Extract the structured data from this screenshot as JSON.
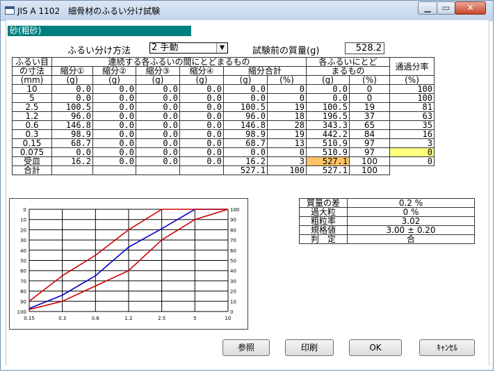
{
  "window": {
    "title": "JIS A 1102　細骨材のふるい分け試験"
  },
  "sample_name": "砂(粗砂)",
  "method": {
    "label": "ふるい分け方法",
    "value": "2 手動"
  },
  "mass_before": {
    "label": "試験前の質量(g)",
    "value": "528.2"
  },
  "table": {
    "headers": {
      "sieve_top": "ふるい目",
      "sieve_bottom": "の寸法",
      "between": "連続する各ふるいの間にとどまるもの",
      "retained_top": "各ふるいにとど",
      "retained_bottom": "まるもの",
      "passing": "通過分率",
      "div1": "縮分①",
      "div2": "縮分②",
      "div3": "縮分③",
      "div4": "縮分④",
      "div_total": "縮分合計"
    },
    "units": [
      "(mm)",
      "(g)",
      "(g)",
      "(g)",
      "(g)",
      "(g)",
      "(%)",
      "(g)",
      "(%)",
      "(%)"
    ],
    "rows": [
      {
        "sieve": "10",
        "d1": "0.0",
        "d2": "0.0",
        "d3": "0.0",
        "d4": "0.0",
        "tg": "0.0",
        "tp": "0",
        "rg": "0.0",
        "rp": "0",
        "pass": "100"
      },
      {
        "sieve": "5",
        "d1": "0.0",
        "d2": "0.0",
        "d3": "0.0",
        "d4": "0.0",
        "tg": "0.0",
        "tp": "0",
        "rg": "0.0",
        "rp": "0",
        "pass": "100"
      },
      {
        "sieve": "2.5",
        "d1": "100.5",
        "d2": "0.0",
        "d3": "0.0",
        "d4": "0.0",
        "tg": "100.5",
        "tp": "19",
        "rg": "100.5",
        "rp": "19",
        "pass": "81"
      },
      {
        "sieve": "1.2",
        "d1": "96.0",
        "d2": "0.0",
        "d3": "0.0",
        "d4": "0.0",
        "tg": "96.0",
        "tp": "18",
        "rg": "196.5",
        "rp": "37",
        "pass": "63"
      },
      {
        "sieve": "0.6",
        "d1": "146.8",
        "d2": "0.0",
        "d3": "0.0",
        "d4": "0.0",
        "tg": "146.8",
        "tp": "28",
        "rg": "343.3",
        "rp": "65",
        "pass": "35"
      },
      {
        "sieve": "0.3",
        "d1": "98.9",
        "d2": "0.0",
        "d3": "0.0",
        "d4": "0.0",
        "tg": "98.9",
        "tp": "19",
        "rg": "442.2",
        "rp": "84",
        "pass": "16"
      },
      {
        "sieve": "0.15",
        "d1": "68.7",
        "d2": "0.0",
        "d3": "0.0",
        "d4": "0.0",
        "tg": "68.7",
        "tp": "13",
        "rg": "510.9",
        "rp": "97",
        "pass": "3"
      },
      {
        "sieve": "0.075",
        "d1": "0.0",
        "d2": "0.0",
        "d3": "0.0",
        "d4": "0.0",
        "tg": "0.0",
        "tp": "0",
        "rg": "510.9",
        "rp": "97",
        "pass": "0"
      }
    ],
    "pan": {
      "sieve": "受皿",
      "d1": "16.2",
      "d2": "0.0",
      "d3": "0.0",
      "d4": "0.0",
      "tg": "16.2",
      "tp": "3",
      "rg": "527.1",
      "rp": "100",
      "pass": "0"
    },
    "total": {
      "label": "合計",
      "tg": "527.1",
      "tp": "100",
      "rg": "527.1",
      "rp": "100"
    }
  },
  "stats": [
    {
      "key": "質量の差",
      "value": "0.2 %"
    },
    {
      "key": "過大粒",
      "value": "0 %"
    },
    {
      "key": "粗粒率",
      "value": "3.02"
    },
    {
      "key": "規格値",
      "value": "3.00 ± 0.20"
    },
    {
      "key": "判　定",
      "value": "合"
    }
  ],
  "buttons": {
    "ref": "参照",
    "print": "印刷",
    "ok": "OK",
    "cancel": "ｷｬﾝｾﾙ"
  },
  "chart_data": {
    "type": "line",
    "x": [
      "0.15",
      "0.3",
      "0.6",
      "1.2",
      "2.5",
      "5",
      "10"
    ],
    "left_ticks": [
      "0",
      "10",
      "20",
      "30",
      "40",
      "50",
      "60",
      "70",
      "80",
      "90",
      "100"
    ],
    "right_ticks": [
      "100",
      "90",
      "80",
      "70",
      "60",
      "50",
      "40",
      "30",
      "20",
      "10",
      "0"
    ],
    "ylim": [
      0,
      100
    ],
    "series": [
      {
        "color": "#0000cc",
        "values": [
          3,
          16,
          35,
          63,
          81,
          100,
          100
        ]
      },
      {
        "color": "#cc0000",
        "values": [
          10,
          35,
          55,
          80,
          100,
          100,
          100
        ]
      },
      {
        "color": "#cc0000",
        "values": [
          2,
          10,
          25,
          40,
          70,
          90,
          100
        ]
      }
    ],
    "grid": true
  }
}
